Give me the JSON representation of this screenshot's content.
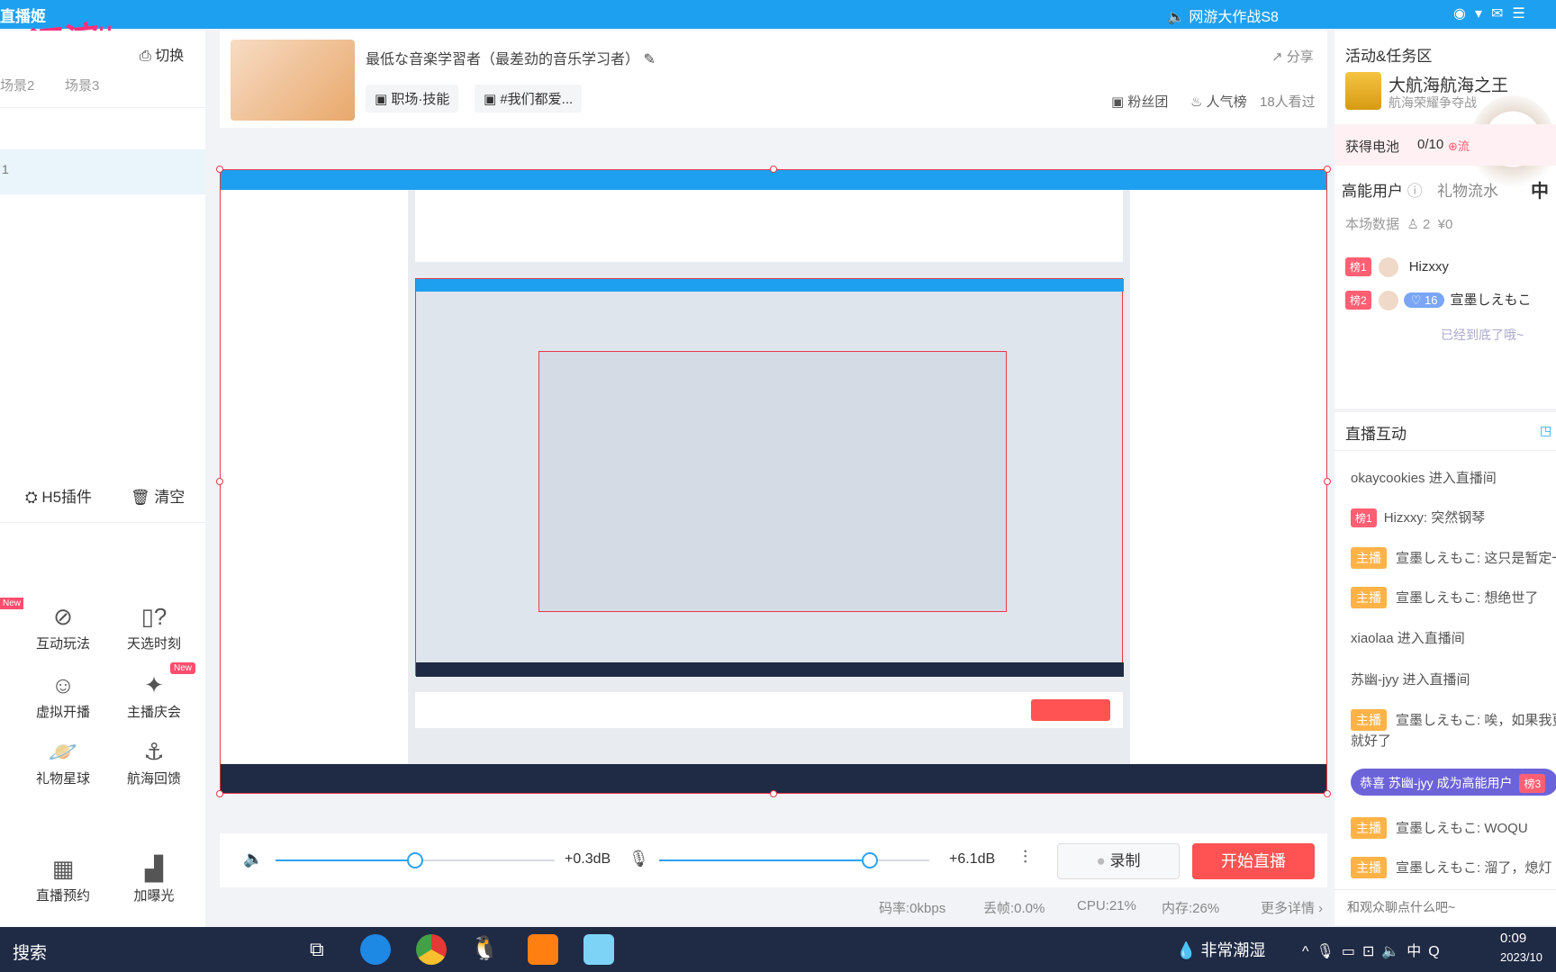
{
  "topbar": {
    "brand": "直播姬",
    "stamp": "#沉淀#",
    "promo": "网游大作战S8"
  },
  "scene": {
    "switch_label": "切换",
    "scenes": [
      "场景2",
      "场景3"
    ],
    "active_item": "1",
    "h5_plugin": "H5插件",
    "clear": "清空"
  },
  "tools": [
    {
      "label": "互动玩法",
      "icon": "interactive-icon",
      "new": true
    },
    {
      "label": "天选时刻",
      "icon": "lottery-icon",
      "new": false
    },
    {
      "label": "虚拟开播",
      "icon": "virtual-icon",
      "new": false
    },
    {
      "label": "主播庆会",
      "icon": "celebration-icon",
      "new": true
    },
    {
      "label": "礼物星球",
      "icon": "planet-icon",
      "new": false
    },
    {
      "label": "航海回馈",
      "icon": "anchor-icon",
      "new": false
    },
    {
      "label": "直播预约",
      "icon": "calendar-icon",
      "new": false
    },
    {
      "label": "加曝光",
      "icon": "chart-icon",
      "new": false
    }
  ],
  "room": {
    "title": "最低な音楽学習者（最差劲的音乐学习者）",
    "category": "职场·技能",
    "tag": "#我们都爱...",
    "share": "分享",
    "fans": "粉丝团",
    "popular": "人气榜",
    "viewers": "18人看过"
  },
  "audio": {
    "desktop_db": "+0.3dB",
    "desktop_level": 0.5,
    "mic_db": "+6.1dB",
    "mic_level": 0.78,
    "record": "录制",
    "start": "开始直播"
  },
  "stats": {
    "bitrate": "码率:0kbps",
    "drop": "丢帧:0.0%",
    "cpu": "CPU:21%",
    "mem": "内存:26%",
    "more": "更多详情"
  },
  "activity": {
    "title": "活动&任务区",
    "event_title": "大航海航海之王",
    "event_sub": "航海荣耀争夺战",
    "battery": "获得电池",
    "battery_val": "0/10",
    "battery_tail": "⊕流",
    "mascot_text": "中"
  },
  "users": {
    "tab1": "高能用户",
    "tab2": "礼物流水",
    "stats": "本场数据",
    "count": "2",
    "money": "¥0",
    "list": [
      {
        "rank": "榜1",
        "name": "Hizxxy"
      },
      {
        "rank": "榜2",
        "name": "宣墨しえもこ",
        "level": "16"
      }
    ],
    "end": "已经到底了哦~"
  },
  "chat": {
    "title": "直播互动",
    "messages": [
      {
        "type": "enter",
        "text": "okaycookies 进入直播间"
      },
      {
        "type": "rank",
        "badge": "榜1",
        "text": "Hizxxy: 突然钢琴"
      },
      {
        "type": "host",
        "badge": "主播",
        "text": "宣墨しえもこ: 这只是暂定一"
      },
      {
        "type": "host",
        "badge": "主播",
        "text": "宣墨しえもこ: 想绝世了"
      },
      {
        "type": "enter",
        "text": "xiaolaa 进入直播间"
      },
      {
        "type": "enter",
        "text": "苏幽-jyy 进入直播间"
      },
      {
        "type": "host",
        "badge": "主播",
        "text": "宣墨しえもこ: 唉，如果我更"
      },
      {
        "type": "plain",
        "text": "就好了"
      },
      {
        "type": "highlight",
        "text": "恭喜 苏幽-jyy 成为高能用户",
        "badge": "榜3"
      },
      {
        "type": "host",
        "badge": "主播",
        "text": "宣墨しえもこ:  WOQU"
      },
      {
        "type": "host",
        "badge": "主播",
        "text": "宣墨しえもこ: 溜了，熄灯"
      }
    ],
    "input_placeholder": "和观众聊点什么吧~"
  },
  "taskbar": {
    "search": "搜索",
    "weather": "非常潮湿",
    "time": "0:09",
    "date": "2023/10"
  }
}
